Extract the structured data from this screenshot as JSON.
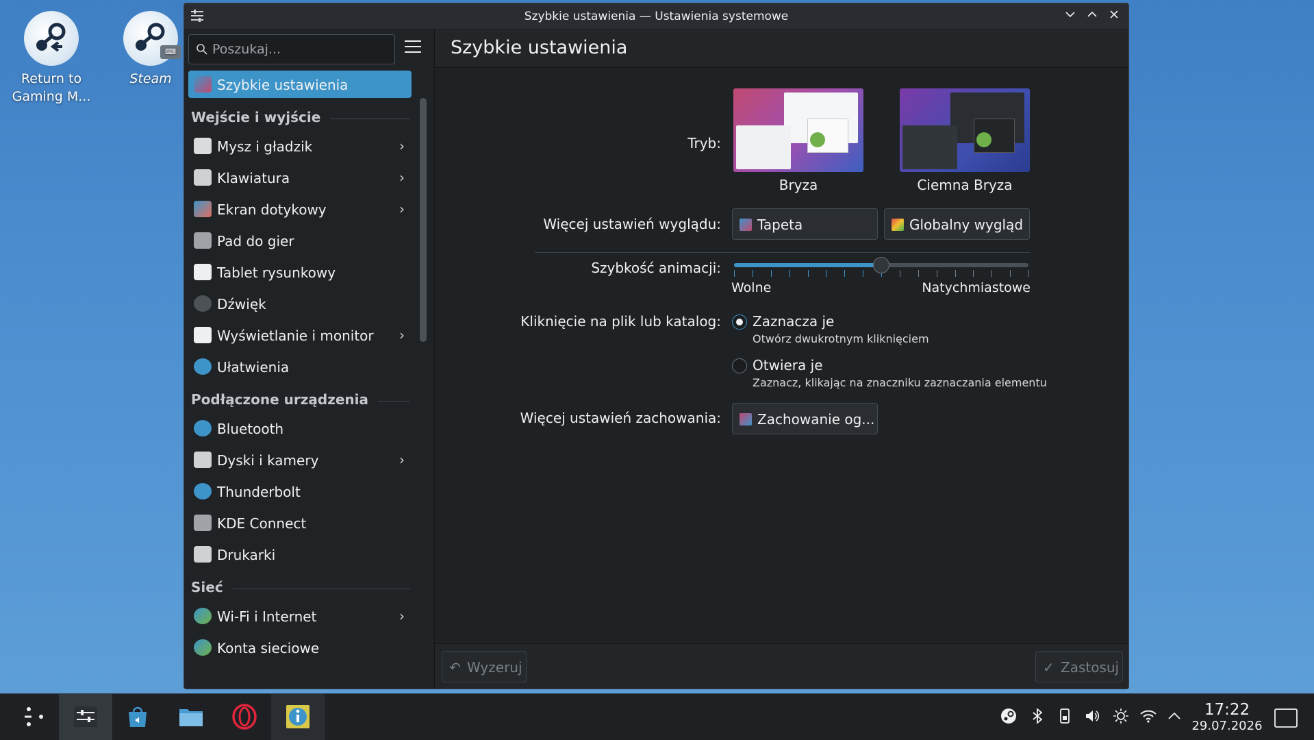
{
  "desktop": {
    "icons": [
      {
        "label_line1": "Return to",
        "label_line2": "Gaming M...",
        "icon": "steam-return-icon"
      },
      {
        "label_line1": "Steam",
        "label_line2": "",
        "icon": "steam-icon"
      }
    ]
  },
  "window": {
    "title": "Szybkie ustawienia — Ustawienia systemowe",
    "buttons": {
      "minimize": "⌄",
      "maximize": "⌃",
      "close": "✕"
    }
  },
  "sidebar": {
    "search_placeholder": "Poszukaj...",
    "items": [
      {
        "type": "item",
        "label": "Szybkie ustawienia",
        "icon": "quick-settings-icon",
        "active": true,
        "chevron": false
      },
      {
        "type": "section",
        "label": "Wejście i wyjście"
      },
      {
        "type": "item",
        "label": "Mysz i gładzik",
        "icon": "mouse-icon",
        "chevron": true
      },
      {
        "type": "item",
        "label": "Klawiatura",
        "icon": "keyboard-icon",
        "chevron": true
      },
      {
        "type": "item",
        "label": "Ekran dotykowy",
        "icon": "touchscreen-icon",
        "chevron": true
      },
      {
        "type": "item",
        "label": "Pad do gier",
        "icon": "gamepad-icon",
        "chevron": false
      },
      {
        "type": "item",
        "label": "Tablet rysunkowy",
        "icon": "tablet-icon",
        "chevron": false
      },
      {
        "type": "item",
        "label": "Dźwięk",
        "icon": "speaker-icon",
        "chevron": false
      },
      {
        "type": "item",
        "label": "Wyświetlanie i monitor",
        "icon": "monitor-icon",
        "chevron": true
      },
      {
        "type": "item",
        "label": "Ułatwienia",
        "icon": "accessibility-icon",
        "chevron": false
      },
      {
        "type": "section",
        "label": "Podłączone urządzenia"
      },
      {
        "type": "item",
        "label": "Bluetooth",
        "icon": "bluetooth-icon",
        "chevron": false
      },
      {
        "type": "item",
        "label": "Dyski i kamery",
        "icon": "disk-icon",
        "chevron": true
      },
      {
        "type": "item",
        "label": "Thunderbolt",
        "icon": "thunderbolt-icon",
        "chevron": false
      },
      {
        "type": "item",
        "label": "KDE Connect",
        "icon": "phone-icon",
        "chevron": false
      },
      {
        "type": "item",
        "label": "Drukarki",
        "icon": "printer-icon",
        "chevron": false
      },
      {
        "type": "section",
        "label": "Sieć"
      },
      {
        "type": "item",
        "label": "Wi-Fi i Internet",
        "icon": "globe-icon",
        "chevron": true
      },
      {
        "type": "item",
        "label": "Konta sieciowe",
        "icon": "network-accounts-icon",
        "chevron": false
      }
    ]
  },
  "content": {
    "title": "Szybkie ustawienia",
    "mode_label": "Tryb:",
    "themes": [
      {
        "name": "Bryza",
        "variant": "light"
      },
      {
        "name": "Ciemna Bryza",
        "variant": "dark"
      }
    ],
    "appearance_label": "Więcej ustawień wyglądu:",
    "wallpaper_button": "Tapeta",
    "global_theme_button": "Globalny wygląd",
    "animation_label": "Szybkość animacji:",
    "animation_min": "Wolne",
    "animation_max": "Natychmiastowe",
    "animation_value_fraction": 0.5,
    "click_label": "Kliknięcie na plik lub katalog:",
    "click_options": [
      {
        "label": "Zaznacza je",
        "description": "Otwórz dwukrotnym kliknięciem",
        "checked": true
      },
      {
        "label": "Otwiera je",
        "description": "Zaznacz, klikając na znaczniku zaznaczania elementu",
        "checked": false
      }
    ],
    "behavior_label": "Więcej ustawień zachowania:",
    "behavior_button": "Zachowanie og...",
    "reset_button": "Wyzeruj",
    "apply_button": "Zastosuj"
  },
  "taskbar": {
    "apps": [
      {
        "name": "app-launcher-icon",
        "active": false
      },
      {
        "name": "system-settings-icon",
        "active": true
      },
      {
        "name": "discover-store-icon",
        "active": false
      },
      {
        "name": "file-manager-icon",
        "active": false
      },
      {
        "name": "opera-browser-icon",
        "active": false
      },
      {
        "name": "info-center-icon",
        "active": false
      }
    ],
    "tray": [
      "steam-tray-icon",
      "bluetooth-tray-icon",
      "storage-tray-icon",
      "volume-icon",
      "brightness-icon",
      "wifi-icon",
      "tray-expand-icon"
    ],
    "time": "17:22",
    "date": "29.07.2026"
  },
  "colors": {
    "accent": "#3d94c9",
    "window_bg": "#202326",
    "taskbar_bg": "#1e2023"
  }
}
